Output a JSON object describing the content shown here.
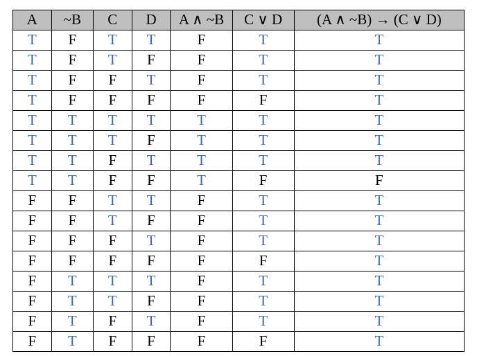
{
  "chart_data": {
    "type": "table",
    "headers": [
      "A",
      "~B",
      "C",
      "D",
      "A ∧ ~B",
      "C ∨ D",
      "(A ∧ ~B) → (C ∨ D)"
    ],
    "rows": [
      [
        "T",
        "F",
        "T",
        "T",
        "F",
        "T",
        "T"
      ],
      [
        "T",
        "F",
        "T",
        "F",
        "F",
        "T",
        "T"
      ],
      [
        "T",
        "F",
        "F",
        "T",
        "F",
        "T",
        "T"
      ],
      [
        "T",
        "F",
        "F",
        "F",
        "F",
        "F",
        "T"
      ],
      [
        "T",
        "T",
        "T",
        "T",
        "T",
        "T",
        "T"
      ],
      [
        "T",
        "T",
        "T",
        "F",
        "T",
        "T",
        "T"
      ],
      [
        "T",
        "T",
        "F",
        "T",
        "T",
        "T",
        "T"
      ],
      [
        "T",
        "T",
        "F",
        "F",
        "T",
        "F",
        "F"
      ],
      [
        "F",
        "F",
        "T",
        "T",
        "F",
        "T",
        "T"
      ],
      [
        "F",
        "F",
        "T",
        "F",
        "F",
        "T",
        "T"
      ],
      [
        "F",
        "F",
        "F",
        "T",
        "F",
        "T",
        "T"
      ],
      [
        "F",
        "F",
        "F",
        "F",
        "F",
        "F",
        "T"
      ],
      [
        "F",
        "T",
        "T",
        "T",
        "F",
        "T",
        "T"
      ],
      [
        "F",
        "T",
        "T",
        "F",
        "F",
        "T",
        "T"
      ],
      [
        "F",
        "T",
        "F",
        "T",
        "F",
        "T",
        "T"
      ],
      [
        "F",
        "T",
        "F",
        "F",
        "F",
        "F",
        "T"
      ]
    ]
  },
  "colors": {
    "true": "#3f6aa8",
    "false": "#000000",
    "header_bg": "#bfbfbf"
  }
}
